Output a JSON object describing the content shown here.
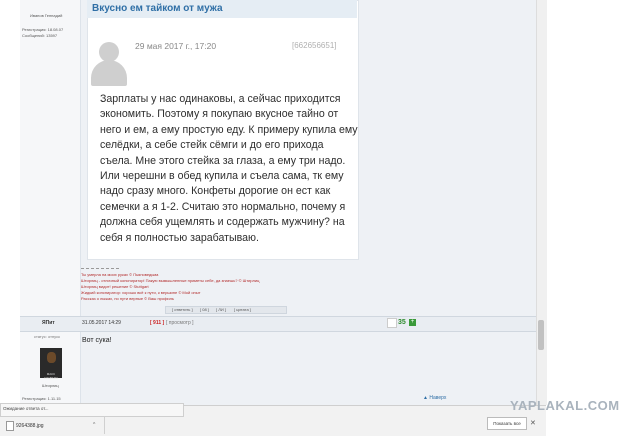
{
  "left_column": {
    "top_name": "Иванов Геннадий",
    "registered": "Регистрация: 18.08.07",
    "messages": "Сообщений: 13597"
  },
  "card": {
    "title": "Вкусно ем тайком от мужа",
    "date": "29 мая 2017 г., 17:20",
    "id": "[662656651]",
    "text": "Зарплаты у нас одинаковы, а сейчас приходится экономить. Поэтому я покупаю вкусное тайно от него и ем, а ему простую еду. К примеру купила ему селёдки, а себе стейк сёмги и до его прихода съела. Мне этого стейка за глаза, а ему три надо. Или черешни в обед купила и съела сама, тк ему надо сразу много. Конфеты дорогие он ест как семечки а я 1-2. Считаю это нормально, почему я должна себя ущемлять и содержать мужчину? на себя я полностью зарабатываю."
  },
  "signature": {
    "separator": "__________________",
    "lines": [
      "Ты умерла на моих руках © Пьяноведьма",
      "Штирлиц - отличный конспиратор! Пакую вымышленные приметы себе, да знаешь? © Штирлиц",
      "Штирлиц видит! решение © Stuttgart",
      "Жидкий конспиратор: хорошо всё к пути, к вершине © Мой опыт",
      "Рассказ о лыжах, по пути верные © Ваш профиль"
    ]
  },
  "bar1": {
    "items": [
      "[ ответить ]",
      "[ 08 ]",
      "[ ЛИ ]",
      "[ цитата ]"
    ]
  },
  "post2": {
    "user": "ЯПит",
    "date": "31.05.2017   14:29",
    "rating": "[ 911 ]",
    "rating_extra": "[ просмотр ]",
    "score": "35",
    "plus": "+",
    "status": "статус: отпуск",
    "avatar_caption": "МАКС СЛАВЬЯН",
    "name": "Штирлиц",
    "registered": "Регистрация: 1.11.15",
    "text": "Вот сука!"
  },
  "back_to_top": "▲ Наверх",
  "status_bar": {
    "text": "Ожидание ответа от..."
  },
  "downloads": {
    "file": "9264388.jpg",
    "caret": "^",
    "show_all": "Показать все",
    "close": "✕"
  },
  "watermark": "YAPLAKAL.COM",
  "colors": {
    "link_blue": "#2f6fa6",
    "signature_red": "#b22a2a",
    "score_green": "#2b8a2b"
  }
}
